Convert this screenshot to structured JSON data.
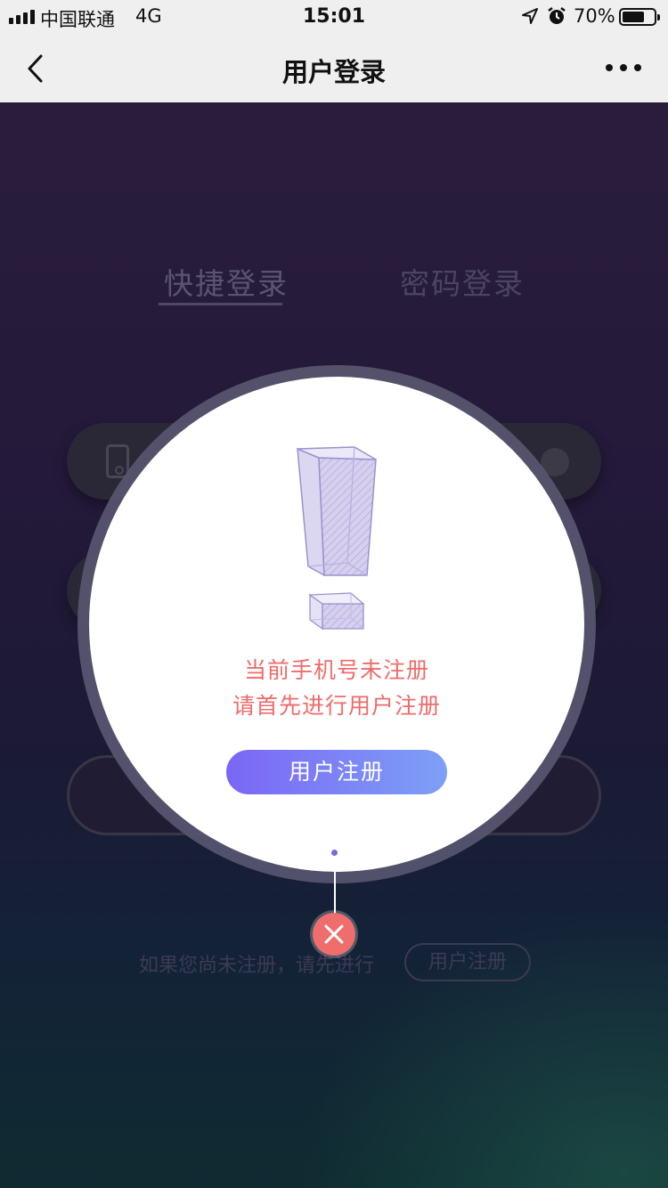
{
  "status_bar": {
    "carrier": "中国联通",
    "network": "4G",
    "time": "15:01",
    "battery_percent": "70%",
    "battery_level": 0.7
  },
  "nav": {
    "title": "用户登录",
    "back_icon": "chevron-left-icon",
    "more_icon": "more-dots-icon"
  },
  "login": {
    "tabs": [
      {
        "label": "快捷登录",
        "active": true
      },
      {
        "label": "密码登录",
        "active": false
      }
    ],
    "footer_hint": "如果您尚未注册，请先进行",
    "footer_register": "用户注册"
  },
  "popup": {
    "icon": "exclamation-icon",
    "message_line1": "当前手机号未注册",
    "message_line2": "请首先进行用户注册",
    "register_label": "用户注册",
    "close_icon": "close-icon"
  },
  "colors": {
    "accent_red": "#f06a6a",
    "button_start": "#7b66f5",
    "button_end": "#7da0f7"
  }
}
